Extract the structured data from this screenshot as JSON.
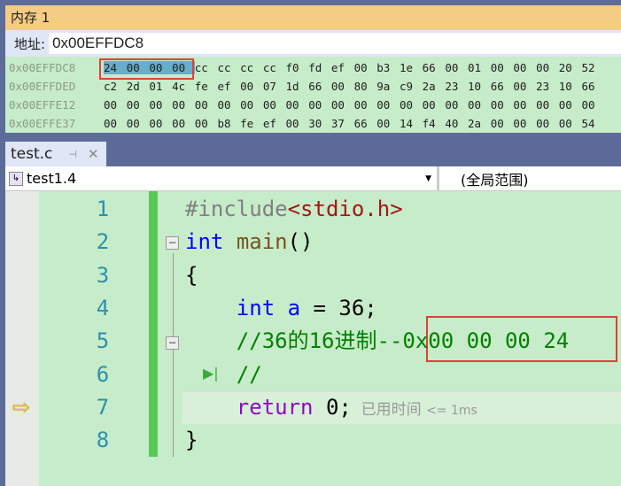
{
  "memory_window": {
    "title": "内存 1",
    "address_label": "地址:",
    "address_value": "0x00EFFDC8",
    "rows": [
      {
        "addr": "0x00EFFDC8",
        "bytes": [
          "24",
          "00",
          "00",
          "00",
          "cc",
          "cc",
          "cc",
          "cc",
          "f0",
          "fd",
          "ef",
          "00",
          "b3",
          "1e",
          "66",
          "00",
          "01",
          "00",
          "00",
          "00",
          "20",
          "52"
        ]
      },
      {
        "addr": "0x00EFFDED",
        "bytes": [
          "c2",
          "2d",
          "01",
          "4c",
          "fe",
          "ef",
          "00",
          "07",
          "1d",
          "66",
          "00",
          "80",
          "9a",
          "c9",
          "2a",
          "23",
          "10",
          "66",
          "00",
          "23",
          "10",
          "66"
        ]
      },
      {
        "addr": "0x00EFFE12",
        "bytes": [
          "00",
          "00",
          "00",
          "00",
          "00",
          "00",
          "00",
          "00",
          "00",
          "00",
          "00",
          "00",
          "00",
          "00",
          "00",
          "00",
          "00",
          "00",
          "00",
          "00",
          "00",
          "00"
        ]
      },
      {
        "addr": "0x00EFFE37",
        "bytes": [
          "00",
          "00",
          "00",
          "00",
          "00",
          "b8",
          "fe",
          "ef",
          "00",
          "30",
          "37",
          "66",
          "00",
          "14",
          "f4",
          "40",
          "2a",
          "00",
          "00",
          "00",
          "00",
          "54"
        ]
      }
    ]
  },
  "tab": {
    "label": "test.c",
    "pin_icon": "pin-icon",
    "close_icon": "close-icon"
  },
  "nav": {
    "project": "test1.4",
    "scope": "(全局范围)"
  },
  "editor": {
    "lines": [
      {
        "n": "1",
        "tokens": [
          {
            "t": "#include",
            "c": "pp"
          },
          {
            "t": "<stdio.h>",
            "c": "str"
          }
        ]
      },
      {
        "n": "2",
        "tokens": [
          {
            "t": "int",
            "c": "kw"
          },
          {
            "t": " ",
            "c": ""
          },
          {
            "t": "main",
            "c": "fn"
          },
          {
            "t": "()",
            "c": ""
          }
        ]
      },
      {
        "n": "3",
        "tokens": [
          {
            "t": "{",
            "c": ""
          }
        ]
      },
      {
        "n": "4",
        "tokens": [
          {
            "t": "    ",
            "c": ""
          },
          {
            "t": "int",
            "c": "kw"
          },
          {
            "t": " ",
            "c": ""
          },
          {
            "t": "a",
            "c": "kw"
          },
          {
            "t": " = 36;",
            "c": ""
          }
        ]
      },
      {
        "n": "5",
        "tokens": [
          {
            "t": "    //36的16进制--0x00 00 00 24",
            "c": "cm"
          }
        ]
      },
      {
        "n": "6",
        "tokens": [
          {
            "t": "    //",
            "c": "cm"
          }
        ]
      },
      {
        "n": "7",
        "tokens": [
          {
            "t": "    ",
            "c": ""
          },
          {
            "t": "return",
            "c": "ret"
          },
          {
            "t": " 0;",
            "c": ""
          }
        ]
      },
      {
        "n": "8",
        "tokens": [
          {
            "t": "}",
            "c": ""
          }
        ]
      }
    ],
    "elapsed_label": "已用时间",
    "elapsed_value": "<= 1ms"
  },
  "colors": {
    "title_bar": "#f5cc84",
    "editor_bg": "#c7ecc9",
    "highlight_box": "#e0403a",
    "selection": "#66aecb"
  }
}
